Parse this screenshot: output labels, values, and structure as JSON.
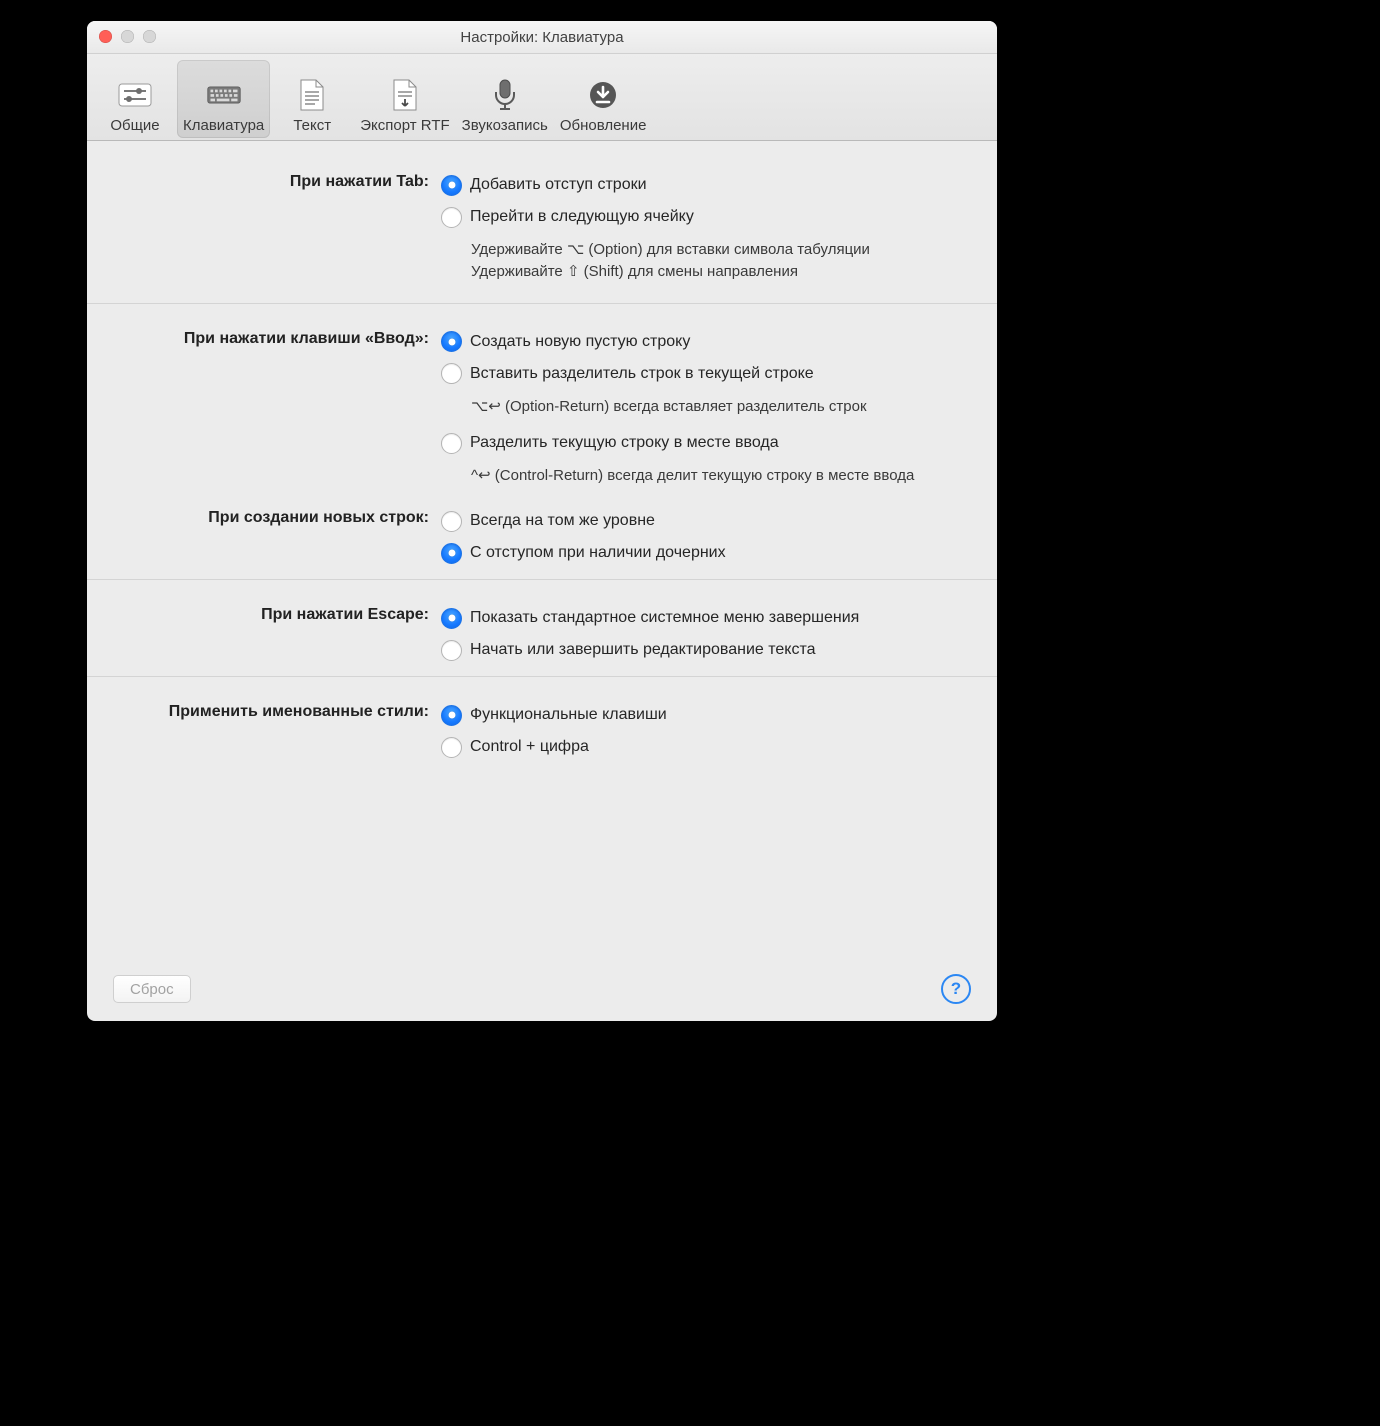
{
  "window": {
    "title": "Настройки: Клавиатура"
  },
  "toolbar": {
    "tabs": [
      {
        "id": "general",
        "label": "Общие"
      },
      {
        "id": "keyboard",
        "label": "Клавиатура",
        "selected": true
      },
      {
        "id": "text",
        "label": "Текст"
      },
      {
        "id": "rtf",
        "label": "Экспорт RTF"
      },
      {
        "id": "audio",
        "label": "Звукозапись"
      },
      {
        "id": "update",
        "label": "Обновление"
      }
    ]
  },
  "sections": {
    "tab": {
      "label": "При нажатии Tab:",
      "options": [
        "Добавить отступ строки",
        "Перейти в следующую ячейку"
      ],
      "selected": 0,
      "hints": [
        "Удерживайте ⌥ (Option) для вставки символа табуляции",
        "Удерживайте ⇧ (Shift) для смены направления"
      ]
    },
    "return": {
      "label": "При нажатии клавиши «Ввод»:",
      "options": [
        "Создать новую пустую строку",
        "Вставить разделитель строк в текущей строке",
        "Разделить текущую строку в месте ввода"
      ],
      "selected": 0,
      "hints": [
        "⌥↩ (Option-Return) всегда вставляет разделитель строк",
        "^↩ (Control-Return) всегда делит текущую строку в месте ввода"
      ]
    },
    "newrows": {
      "label": "При создании новых строк:",
      "options": [
        "Всегда на том же уровне",
        "С отступом при наличии дочерних"
      ],
      "selected": 1
    },
    "escape": {
      "label": "При нажатии Escape:",
      "options": [
        "Показать стандартное системное меню завершения",
        "Начать или завершить редактирование текста"
      ],
      "selected": 0
    },
    "styles": {
      "label": "Применить именованные стили:",
      "options": [
        "Функциональные клавиши",
        "Control + цифра"
      ],
      "selected": 0
    }
  },
  "footer": {
    "reset": "Сброс",
    "help": "?"
  }
}
